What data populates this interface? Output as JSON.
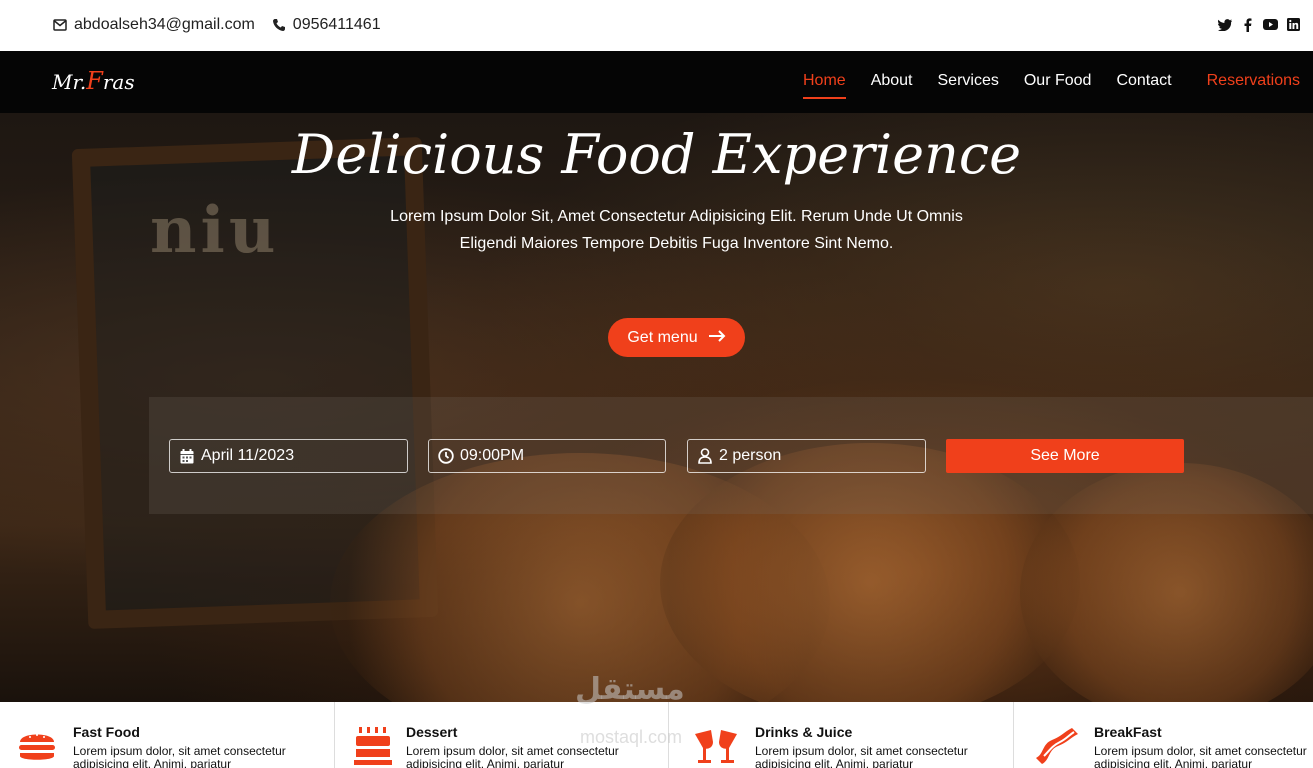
{
  "topbar": {
    "email": "abdoalseh34@gmail.com",
    "phone": "0956411461",
    "email_icon": "envelope-icon",
    "phone_icon": "phone-icon",
    "social": [
      "twitter-icon",
      "facebook-icon",
      "youtube-icon",
      "linkedin-icon"
    ]
  },
  "nav": {
    "logo_prefix": "Mr.",
    "logo_highlight": "F",
    "logo_suffix": "ras",
    "items": [
      {
        "label": "Home",
        "active": true
      },
      {
        "label": "About",
        "active": false
      },
      {
        "label": "Services",
        "active": false
      },
      {
        "label": "Our Food",
        "active": false
      },
      {
        "label": "Contact",
        "active": false
      }
    ],
    "reservations": "Reservations"
  },
  "hero": {
    "title": "Delicious Food Experience",
    "subtitle_line1": "Lorem Ipsum Dolor Sit, Amet Consectetur Adipisicing Elit. Rerum Unde Ut Omnis",
    "subtitle_line2": "Eligendi Maiores Tempore Debitis Fuga Inventore Sint Nemo.",
    "cta": "Get menu",
    "board_text": "niu"
  },
  "booking": {
    "date": "April 11/2023",
    "time": "09:00PM",
    "people": "2 person",
    "submit": "See More"
  },
  "categories": [
    {
      "title": "Fast Food",
      "line1": "Lorem ipsum dolor, sit amet consectetur",
      "line2": "adipisicing elit. Animi, pariatur",
      "icon": "burger-icon"
    },
    {
      "title": "Dessert",
      "line1": "Lorem ipsum dolor, sit amet consectetur",
      "line2": "adipisicing elit. Animi, pariatur",
      "icon": "cake-icon"
    },
    {
      "title": "Drinks & Juice",
      "line1": "Lorem ipsum dolor, sit amet consectetur",
      "line2": "adipisicing elit. Animi, pariatur",
      "icon": "glasses-icon"
    },
    {
      "title": "BreakFast",
      "line1": "Lorem ipsum dolor, sit amet consectetur",
      "line2": "adipisicing elit. Animi, pariatur",
      "icon": "bacon-icon"
    }
  ],
  "watermark": {
    "arabic": "مستقل",
    "latin": "mostaql.com"
  },
  "colors": {
    "accent": "#f0401b",
    "nav_bg": "#050505"
  }
}
